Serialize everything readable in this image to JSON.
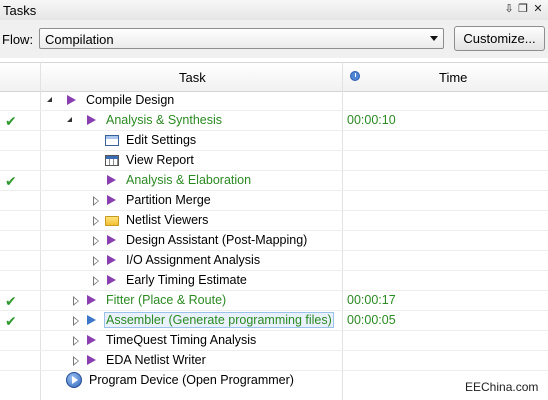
{
  "window": {
    "title": "Tasks",
    "pin_glyph": "⇩",
    "float_glyph": "❐",
    "close_glyph": "✕"
  },
  "flow": {
    "label": "Flow:",
    "selected": "Compilation",
    "customize_label": "Customize..."
  },
  "table": {
    "headers": {
      "task": "Task",
      "time": "Time"
    },
    "rows": [
      {
        "name": "Compile Design",
        "icon": "play-icon",
        "expander": "open",
        "status": "",
        "time": ""
      },
      {
        "name": "Analysis & Synthesis",
        "icon": "play-icon",
        "expander": "open",
        "status": "done",
        "time": "00:00:10"
      },
      {
        "name": "Edit Settings",
        "icon": "settings-icon",
        "expander": "none",
        "status": "",
        "time": ""
      },
      {
        "name": "View Report",
        "icon": "report-icon",
        "expander": "none",
        "status": "",
        "time": ""
      },
      {
        "name": "Analysis & Elaboration",
        "icon": "play-icon",
        "expander": "none",
        "status": "done",
        "time": ""
      },
      {
        "name": "Partition Merge",
        "icon": "play-icon",
        "expander": "closed",
        "status": "",
        "time": ""
      },
      {
        "name": "Netlist Viewers",
        "icon": "folder-icon",
        "expander": "closed",
        "status": "",
        "time": ""
      },
      {
        "name": "Design Assistant (Post-Mapping)",
        "icon": "play-icon",
        "expander": "closed",
        "status": "",
        "time": ""
      },
      {
        "name": "I/O Assignment Analysis",
        "icon": "play-icon",
        "expander": "closed",
        "status": "",
        "time": ""
      },
      {
        "name": "Early Timing Estimate",
        "icon": "play-icon",
        "expander": "closed",
        "status": "",
        "time": ""
      },
      {
        "name": "Fitter (Place & Route)",
        "icon": "play-icon",
        "expander": "closed",
        "status": "done",
        "time": "00:00:17"
      },
      {
        "name": "Assembler (Generate programming files)",
        "icon": "play-icon-blue",
        "expander": "closed",
        "status": "done",
        "time": "00:00:05"
      },
      {
        "name": "TimeQuest Timing Analysis",
        "icon": "play-icon",
        "expander": "closed",
        "status": "",
        "time": ""
      },
      {
        "name": "EDA Netlist Writer",
        "icon": "play-icon",
        "expander": "closed",
        "status": "",
        "time": ""
      },
      {
        "name": "Program Device (Open Programmer)",
        "icon": "device-icon",
        "expander": "none",
        "status": "",
        "time": ""
      }
    ]
  },
  "colors": {
    "completed_text": "#2b8a22",
    "check": "#2e9a2e",
    "task_icon": "#8a3fb0",
    "selection": "#e8f1fc"
  },
  "watermark": "EEChina.com"
}
